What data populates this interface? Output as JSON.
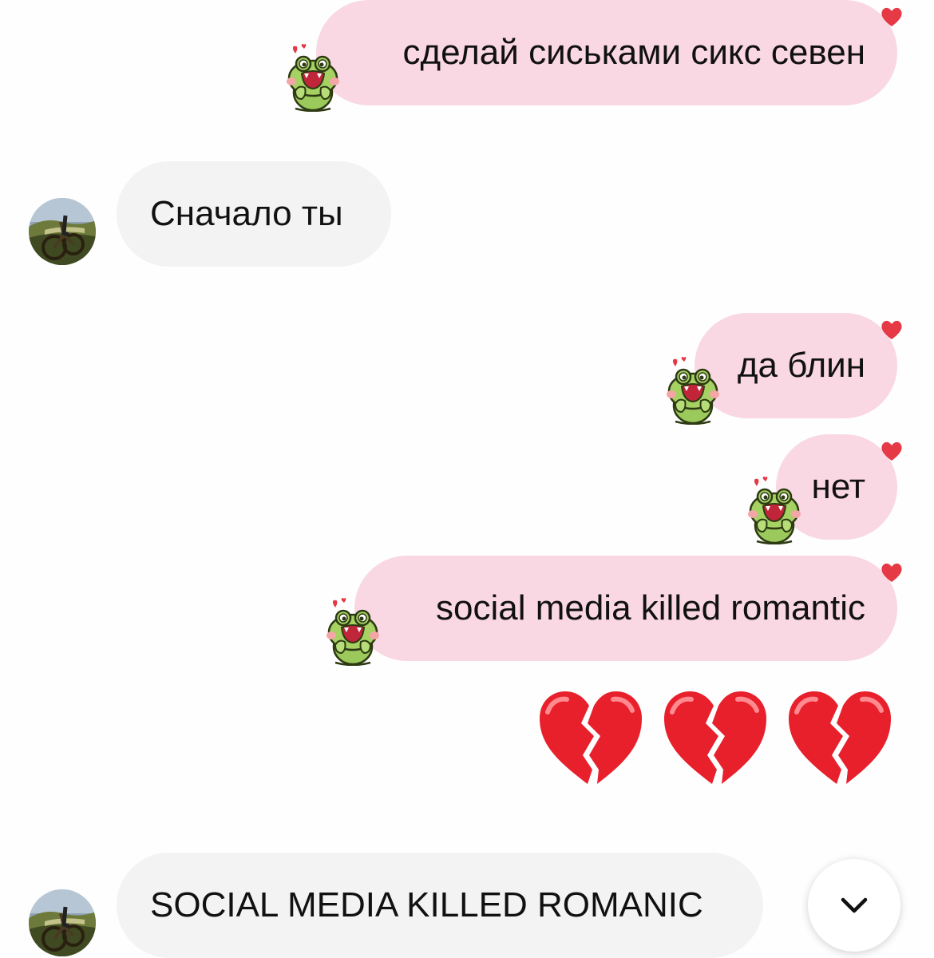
{
  "messages": [
    {
      "side": "out",
      "text": "сделай сиськами сикс севен"
    },
    {
      "side": "in",
      "text": "Сначало ты"
    },
    {
      "side": "out",
      "text": "да блин"
    },
    {
      "side": "out",
      "text": "нет"
    },
    {
      "side": "out",
      "text": "social media killed romantic"
    },
    {
      "side": "out",
      "emoji": "💔💔💔",
      "icon": "broken-heart-icon"
    },
    {
      "side": "in",
      "text": "SOCIAL MEDIA KILLED ROMANIC"
    }
  ],
  "reaction_icon": "red-heart-icon",
  "sticker_icon": "frog-sticker-icon",
  "avatar_icon": "bike-avatar-icon",
  "scroll_icon": "chevron-down-icon",
  "colors": {
    "outgoing_bubble": "#f9d7e3",
    "incoming_bubble": "#f3f3f3",
    "reaction_heart": "#e53945",
    "background": "#fefefe"
  }
}
